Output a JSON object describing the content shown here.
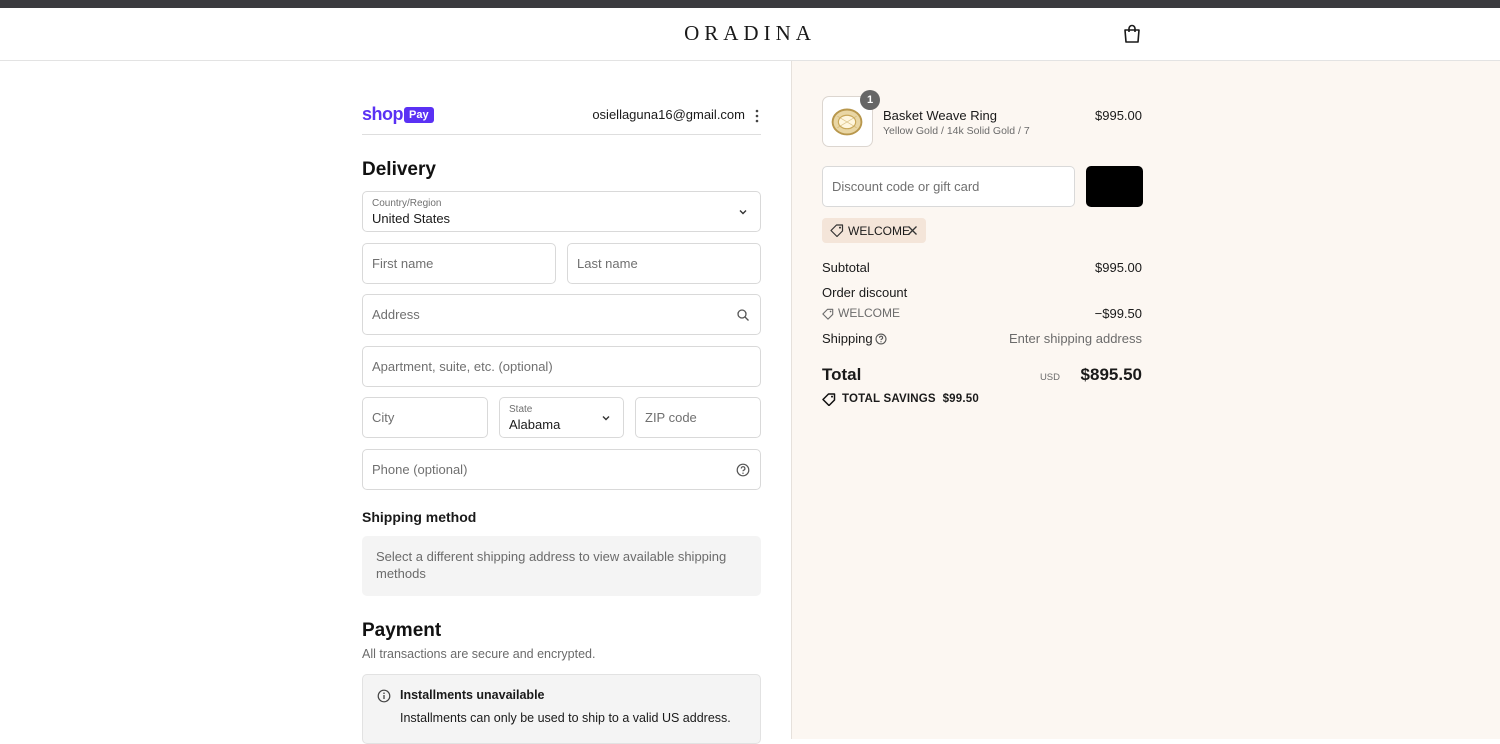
{
  "header": {
    "logo": "ORADINA",
    "cart_icon": "shopping-bag-icon"
  },
  "shop_pay": {
    "brand_text": "shop",
    "badge_text": "Pay",
    "email": "osiellaguna16@gmail.com"
  },
  "delivery": {
    "heading": "Delivery",
    "country": {
      "label": "Country/Region",
      "value": "United States"
    },
    "first_name_placeholder": "First name",
    "last_name_placeholder": "Last name",
    "address_placeholder": "Address",
    "apartment_placeholder": "Apartment, suite, etc. (optional)",
    "city_placeholder": "City",
    "state": {
      "label": "State",
      "value": "Alabama"
    },
    "zip_placeholder": "ZIP code",
    "phone_placeholder": "Phone (optional)"
  },
  "shipping_method": {
    "heading": "Shipping method",
    "message": "Select a different shipping address to view available shipping methods"
  },
  "payment": {
    "heading": "Payment",
    "subtitle": "All transactions are secure and encrypted.",
    "notice_title": "Installments unavailable",
    "notice_text": "Installments can only be used to ship to a valid US address."
  },
  "order": {
    "item": {
      "quantity": "1",
      "name": "Basket Weave Ring",
      "variant": "Yellow Gold / 14k Solid Gold / 7",
      "price": "$995.00"
    },
    "discount_placeholder": "Discount code or gift card",
    "applied_code": "WELCOME",
    "subtotal_label": "Subtotal",
    "subtotal_value": "$995.00",
    "order_discount_label": "Order discount",
    "discount_code": "WELCOME",
    "discount_value": "−$99.50",
    "shipping_label": "Shipping",
    "shipping_value": "Enter shipping address",
    "total_label": "Total",
    "total_currency": "USD",
    "total_value": "$895.50",
    "savings_label": "TOTAL SAVINGS",
    "savings_value": "$99.50"
  },
  "colors": {
    "shop_pay_purple": "#5a31f4",
    "summary_background": "#fcf7f2",
    "chip_background": "#f4e5d9"
  }
}
